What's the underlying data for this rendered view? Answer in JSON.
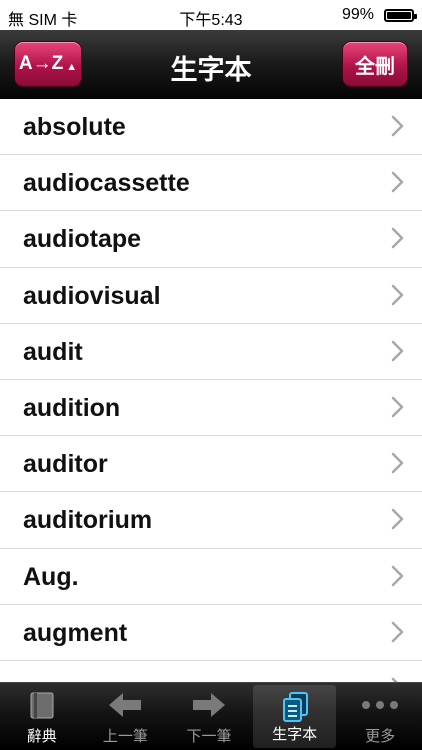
{
  "status_bar": {
    "carrier": "無 SIM 卡",
    "time": "下午5:43",
    "battery": "99%",
    "battery_level": 0.99
  },
  "nav": {
    "title": "生字本",
    "az_button": "A→Z",
    "az_indicator": "▲",
    "delete_all_button": "全刪"
  },
  "words": [
    "absolute",
    "audiocassette",
    "audiotape",
    "audiovisual",
    "audit",
    "audition",
    "auditor",
    "auditorium",
    "Aug.",
    "augment",
    ""
  ],
  "tabs": [
    {
      "label": "辭典",
      "icon": "book-icon"
    },
    {
      "label": "上一筆",
      "icon": "arrow-left-icon"
    },
    {
      "label": "下一筆",
      "icon": "arrow-right-icon"
    },
    {
      "label": "生字本",
      "icon": "notebook-icon",
      "active": true
    },
    {
      "label": "更多",
      "icon": "more-dots-icon"
    }
  ],
  "colors": {
    "accent": "#c2185b",
    "tab_active": "#4fc3f7"
  }
}
